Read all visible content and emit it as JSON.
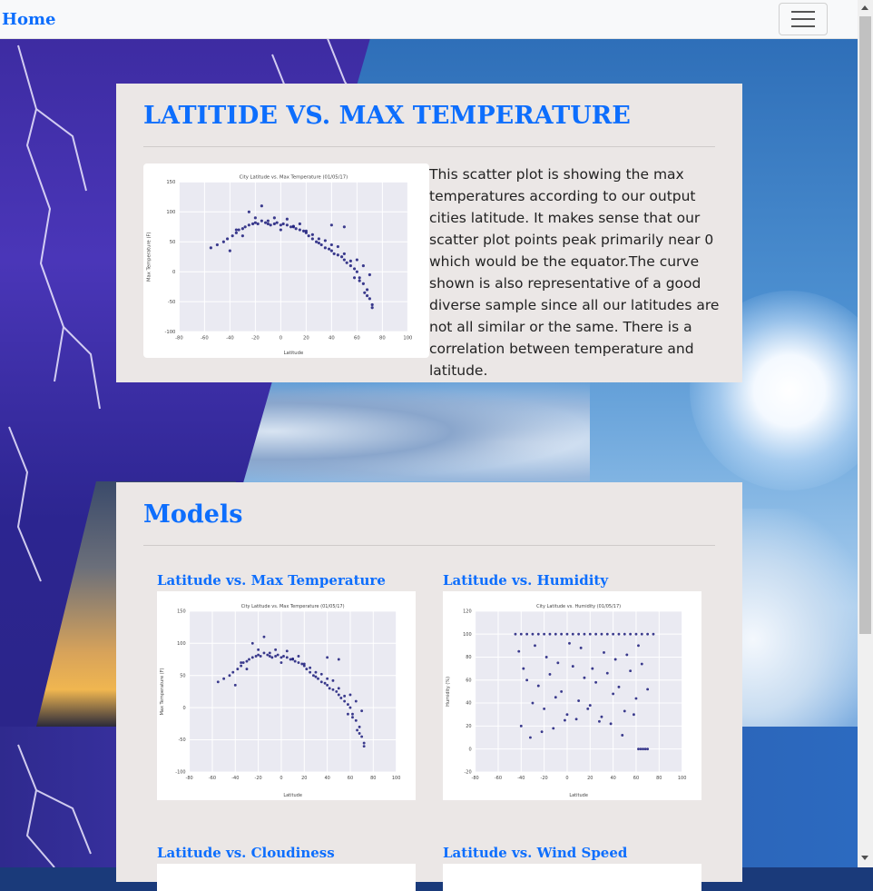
{
  "navbar": {
    "brand": "Home"
  },
  "hero": {
    "title": "LATITIDE VS. MAX TEMPERATURE",
    "description": "This scatter plot is showing the max temperatures according to our output cities latitude. It makes sense that our scatter plot points peak primarily near 0 which would be the equator.The curve shown is also representative of a good diverse sample since all our latitudes are not all similar or the same. There is a correlation between temperature and latitude."
  },
  "models": {
    "title": "Models",
    "items": [
      {
        "label": "Latitude vs. Max Temperature"
      },
      {
        "label": "Latitude vs. Humidity"
      },
      {
        "label": "Latitude vs. Cloudiness"
      },
      {
        "label": "Latitude vs. Wind Speed"
      }
    ]
  },
  "chart_data": [
    {
      "type": "scatter",
      "title": "City Latitude vs. Max Temperature (01/05/17)",
      "xlabel": "Latitude",
      "ylabel": "Max Temperature (F)",
      "xlim": [
        -80,
        100
      ],
      "ylim": [
        -100,
        150
      ],
      "xticks": [
        -80,
        -60,
        -40,
        -20,
        0,
        20,
        40,
        60,
        80,
        100
      ],
      "yticks": [
        -100,
        -50,
        0,
        50,
        100,
        150
      ],
      "grid": true,
      "points_desc": "approximate sample of plotted points",
      "x": [
        -55,
        -50,
        -45,
        -42,
        -38,
        -35,
        -33,
        -30,
        -28,
        -25,
        -22,
        -20,
        -18,
        -15,
        -12,
        -10,
        -8,
        -5,
        -3,
        0,
        2,
        5,
        8,
        10,
        12,
        15,
        18,
        20,
        22,
        25,
        28,
        30,
        32,
        35,
        38,
        40,
        42,
        45,
        48,
        50,
        52,
        55,
        58,
        60,
        62,
        65,
        68,
        70,
        72,
        -40,
        -30,
        -20,
        -10,
        0,
        10,
        20,
        30,
        40,
        50,
        60,
        65,
        70,
        -25,
        -15,
        -5,
        5,
        15,
        25,
        35,
        45,
        55,
        62,
        68,
        72,
        -35,
        40,
        50,
        58,
        66
      ],
      "y": [
        40,
        45,
        50,
        55,
        60,
        65,
        70,
        72,
        75,
        78,
        80,
        82,
        80,
        85,
        82,
        80,
        78,
        80,
        82,
        78,
        80,
        78,
        75,
        76,
        72,
        70,
        68,
        65,
        60,
        55,
        50,
        48,
        45,
        40,
        38,
        35,
        30,
        28,
        25,
        20,
        15,
        10,
        5,
        0,
        -10,
        -20,
        -30,
        -45,
        -60,
        35,
        60,
        90,
        85,
        70,
        75,
        68,
        55,
        45,
        30,
        20,
        10,
        -5,
        100,
        110,
        90,
        88,
        80,
        62,
        52,
        42,
        18,
        -15,
        -40,
        -55,
        70,
        78,
        75,
        -10,
        -35
      ]
    },
    {
      "type": "scatter",
      "title": "City Latitude vs. Max Temperature (01/05/17)",
      "xlabel": "Latitude",
      "ylabel": "Max Temperature (F)",
      "xlim": [
        -80,
        100
      ],
      "ylim": [
        -100,
        150
      ],
      "xticks": [
        -80,
        -60,
        -40,
        -20,
        0,
        20,
        40,
        60,
        80,
        100
      ],
      "yticks": [
        -100,
        -50,
        0,
        50,
        100,
        150
      ],
      "grid": true
    },
    {
      "type": "scatter",
      "title": "City Latitude vs. Humidity (01/05/17)",
      "xlabel": "Latitude",
      "ylabel": "Humidity (%)",
      "xlim": [
        -80,
        100
      ],
      "ylim": [
        -20,
        120
      ],
      "xticks": [
        -80,
        -60,
        -40,
        -20,
        0,
        20,
        40,
        60,
        80,
        100
      ],
      "yticks": [
        -20,
        0,
        20,
        40,
        60,
        80,
        100,
        120
      ],
      "grid": true,
      "x": [
        -45,
        -40,
        -35,
        -30,
        -25,
        -20,
        -15,
        -10,
        -5,
        0,
        5,
        10,
        15,
        20,
        25,
        30,
        35,
        40,
        45,
        50,
        55,
        60,
        65,
        70,
        75,
        -42,
        -38,
        -28,
        -18,
        -8,
        2,
        12,
        22,
        32,
        42,
        52,
        62,
        -35,
        -25,
        -15,
        -5,
        5,
        15,
        25,
        35,
        45,
        55,
        65,
        -30,
        -20,
        -10,
        0,
        10,
        20,
        30,
        40,
        50,
        60,
        70,
        -40,
        -22,
        -2,
        18,
        38,
        58,
        62,
        64,
        66,
        68,
        70,
        -32,
        -12,
        8,
        28,
        48
      ],
      "y": [
        100,
        100,
        100,
        100,
        100,
        100,
        100,
        100,
        100,
        100,
        100,
        100,
        100,
        100,
        100,
        100,
        100,
        100,
        100,
        100,
        100,
        100,
        100,
        100,
        100,
        85,
        70,
        90,
        80,
        75,
        92,
        88,
        70,
        84,
        78,
        82,
        90,
        60,
        55,
        65,
        50,
        72,
        62,
        58,
        66,
        54,
        68,
        74,
        40,
        35,
        45,
        30,
        42,
        38,
        28,
        48,
        33,
        44,
        52,
        20,
        15,
        25,
        35,
        22,
        30,
        0,
        0,
        0,
        0,
        0,
        10,
        18,
        26,
        24,
        12
      ]
    },
    {
      "type": "scatter",
      "title": "City Latitude vs. Humidity (01/05/17)",
      "xlabel": "Latitude",
      "ylabel": "Humidity (%)",
      "xlim": [
        -80,
        100
      ],
      "ylim": [
        -20,
        120
      ],
      "xticks": [
        -80,
        -60,
        -40,
        -20,
        0,
        20,
        40,
        60,
        80,
        100
      ],
      "yticks": [
        -20,
        0,
        20,
        40,
        60,
        80,
        100,
        120
      ],
      "grid": true
    }
  ]
}
